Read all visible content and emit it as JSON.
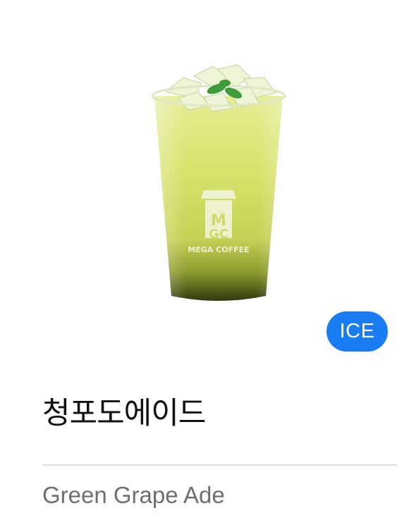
{
  "product": {
    "image_icon": "green-grape-ade-drink-image",
    "logo_text": "MEGA COFFEE",
    "badge": "ICE",
    "name_ko": "청포도에이드",
    "name_en": "Green Grape Ade"
  },
  "colors": {
    "badge_bg": "#1a7cf3",
    "drink_top": "#e3ea8c",
    "drink_mid": "#c9d650",
    "drink_bottom": "#3b4a12"
  }
}
